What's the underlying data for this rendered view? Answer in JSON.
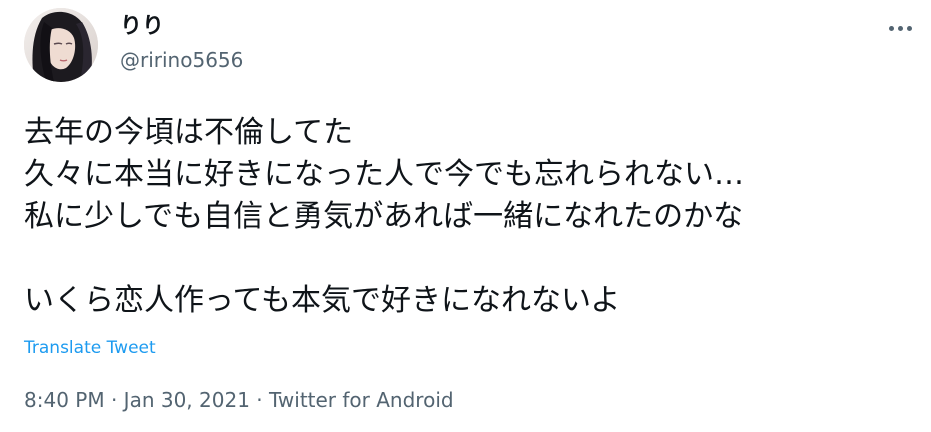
{
  "tweet": {
    "author": {
      "display_name": "りり",
      "handle": "@ririno5656",
      "avatar_icon": "profile-photo"
    },
    "text_lines": [
      "去年の今頃は不倫してた",
      "久々に本当に好きになった人で今でも忘れられない…",
      "私に少しでも自信と勇気があれば一緒になれたのかな",
      "",
      "いくら恋人作っても本気で好きになれないよ"
    ],
    "translate_label": "Translate Tweet",
    "time": "8:40 PM",
    "separator": "·",
    "date": "Jan 30, 2021",
    "source": "Twitter for Android",
    "more_icon": "more-horizontal-icon"
  },
  "colors": {
    "text": "#0f1419",
    "secondary": "#536471",
    "link": "#1d9bf0"
  }
}
